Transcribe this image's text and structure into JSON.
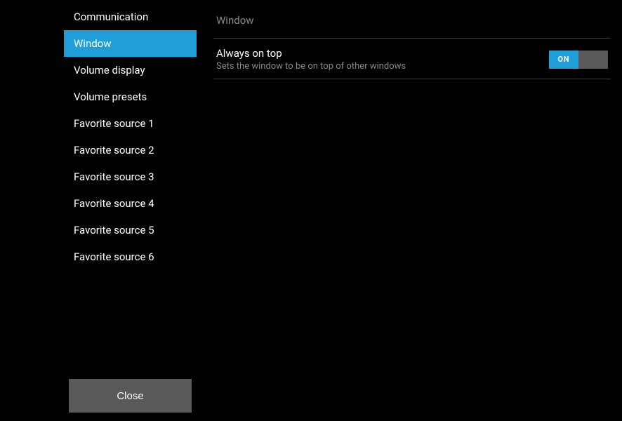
{
  "sidebar": {
    "items": [
      {
        "label": "Communication",
        "selected": false
      },
      {
        "label": "Window",
        "selected": true
      },
      {
        "label": "Volume display",
        "selected": false
      },
      {
        "label": "Volume presets",
        "selected": false
      },
      {
        "label": "Favorite source 1",
        "selected": false
      },
      {
        "label": "Favorite source 2",
        "selected": false
      },
      {
        "label": "Favorite source 3",
        "selected": false
      },
      {
        "label": "Favorite source 4",
        "selected": false
      },
      {
        "label": "Favorite source 5",
        "selected": false
      },
      {
        "label": "Favorite source 6",
        "selected": false
      }
    ],
    "close_label": "Close"
  },
  "main": {
    "header": "Window",
    "settings": [
      {
        "title": "Always on top",
        "description": "Sets the window to be on top of other windows",
        "toggle_state": "ON"
      }
    ]
  }
}
